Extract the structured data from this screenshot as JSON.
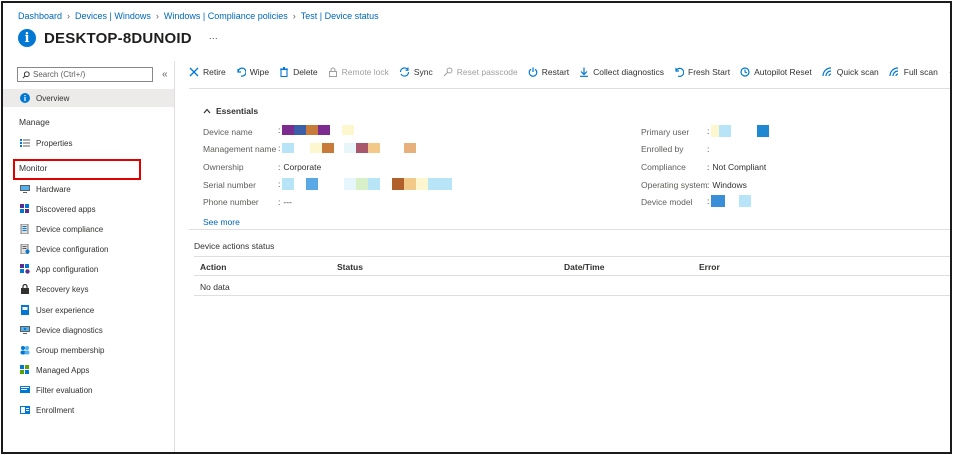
{
  "breadcrumb": [
    "Dashboard",
    "Devices | Windows",
    "Windows | Compliance policies",
    "Test | Device status"
  ],
  "page": {
    "title": "DESKTOP-8DUNOID",
    "more": "···"
  },
  "sidebar": {
    "search_placeholder": "Search (Ctrl+/)",
    "collapse": "«",
    "overview": "Overview",
    "manage_heading": "Manage",
    "properties": "Properties",
    "monitor_heading": "Monitor",
    "monitor_items": [
      "Hardware",
      "Discovered apps",
      "Device compliance",
      "Device configuration",
      "App configuration",
      "Recovery keys",
      "User experience",
      "Device diagnostics",
      "Group membership",
      "Managed Apps",
      "Filter evaluation",
      "Enrollment"
    ],
    "highlighted_item": "Device compliance"
  },
  "toolbar": {
    "items": [
      {
        "label": "Retire",
        "icon": "x-icon",
        "enabled": true
      },
      {
        "label": "Wipe",
        "icon": "undo-icon",
        "enabled": true
      },
      {
        "label": "Delete",
        "icon": "trash-icon",
        "enabled": true
      },
      {
        "label": "Remote lock",
        "icon": "lock-icon",
        "enabled": false
      },
      {
        "label": "Sync",
        "icon": "sync-icon",
        "enabled": true
      },
      {
        "label": "Reset passcode",
        "icon": "key-icon",
        "enabled": false
      },
      {
        "label": "Restart",
        "icon": "power-icon",
        "enabled": true
      },
      {
        "label": "Collect diagnostics",
        "icon": "download-icon",
        "enabled": true
      },
      {
        "label": "Fresh Start",
        "icon": "refresh-icon",
        "enabled": true
      },
      {
        "label": "Autopilot Reset",
        "icon": "clock-icon",
        "enabled": true
      },
      {
        "label": "Quick scan",
        "icon": "scan-icon",
        "enabled": true
      },
      {
        "label": "Full scan",
        "icon": "scan-icon",
        "enabled": true
      }
    ],
    "more": "···"
  },
  "essentials": {
    "heading": "Essentials",
    "left": [
      {
        "label": "Device name",
        "value": ""
      },
      {
        "label": "Management name",
        "value": ""
      },
      {
        "label": "Ownership",
        "value": "Corporate"
      },
      {
        "label": "Serial number",
        "value": ""
      },
      {
        "label": "Phone number",
        "value": "---"
      }
    ],
    "right": [
      {
        "label": "Primary user",
        "value": ""
      },
      {
        "label": "Enrolled by",
        "value": ""
      },
      {
        "label": "Compliance",
        "value": "Not Compliant"
      },
      {
        "label": "Operating system",
        "value": "Windows"
      },
      {
        "label": "Device model",
        "value": ""
      }
    ],
    "see_more": "See more",
    "separator": ":"
  },
  "device_actions": {
    "title": "Device actions status",
    "columns": [
      "Action",
      "Status",
      "Date/Time",
      "Error"
    ],
    "empty_text": "No data"
  },
  "colors": {
    "accent": "#0078d4",
    "link": "#0067b8",
    "highlight_border": "#e00000"
  }
}
